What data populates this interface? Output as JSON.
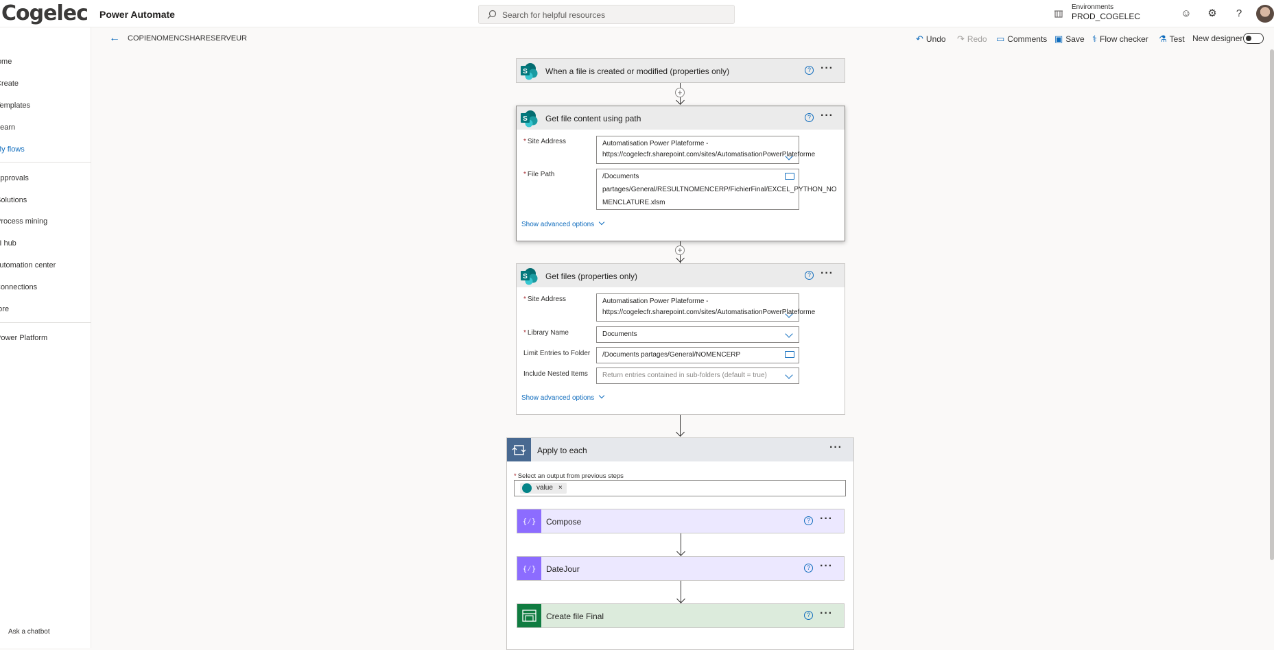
{
  "header": {
    "logo": "Cogelec",
    "app_name": "Power Automate",
    "search_placeholder": "Search for helpful resources",
    "env_label": "Environments",
    "env_value": "PROD_COGELEC"
  },
  "sidebar": {
    "items": [
      {
        "label": "Home"
      },
      {
        "label": "Create"
      },
      {
        "label": "Templates"
      },
      {
        "label": "Learn"
      },
      {
        "label": "My flows"
      },
      {
        "label": "Approvals"
      },
      {
        "label": "Solutions"
      },
      {
        "label": "Process mining"
      },
      {
        "label": "AI hub"
      },
      {
        "label": "Automation center"
      },
      {
        "label": "Connections"
      },
      {
        "label": "More"
      },
      {
        "label": "Power Platform"
      }
    ],
    "chatbot": "Ask a chatbot"
  },
  "commandbar": {
    "flow_name": "COPIENOMENCSHARESERVEUR",
    "undo": "Undo",
    "redo": "Redo",
    "comments": "Comments",
    "save": "Save",
    "flow_checker": "Flow checker",
    "test": "Test",
    "new_designer": "New designer"
  },
  "flow": {
    "trigger": {
      "title": "When a file is created or modified (properties only)"
    },
    "get_content": {
      "title": "Get file content using path",
      "site_label": "Site Address",
      "site_line1": "Automatisation Power Plateforme -",
      "site_line2": "https://cogelecfr.sharepoint.com/sites/AutomatisationPowerPlateforme",
      "path_label": "File Path",
      "path_line1": "/Documents",
      "path_line2": "partages/General/RESULTNOMENCERP/FichierFinal/EXCEL_PYTHON_NO",
      "path_line3": "MENCLATURE.xlsm",
      "advanced": "Show advanced options"
    },
    "get_files": {
      "title": "Get files (properties only)",
      "site_label": "Site Address",
      "site_line1": "Automatisation Power Plateforme -",
      "site_line2": "https://cogelecfr.sharepoint.com/sites/AutomatisationPowerPlateforme",
      "library_label": "Library Name",
      "library_value": "Documents",
      "limit_label": "Limit Entries to Folder",
      "limit_value": "/Documents partages/General/NOMENCERP",
      "nested_label": "Include Nested Items",
      "nested_placeholder": "Return entries contained in sub-folders (default = true)",
      "advanced": "Show advanced options"
    },
    "apply_each": {
      "title": "Apply to each",
      "select_label": "Select an output from previous steps",
      "token": "value",
      "actions": [
        {
          "title": "Compose"
        },
        {
          "title": "DateJour"
        },
        {
          "title": "Create file Final"
        }
      ]
    }
  },
  "colors": {
    "sharepoint": "#038387",
    "compose": "#8c6cff",
    "excel": "#107c41",
    "loop": "#486991",
    "accent": "#0f6cbd"
  }
}
